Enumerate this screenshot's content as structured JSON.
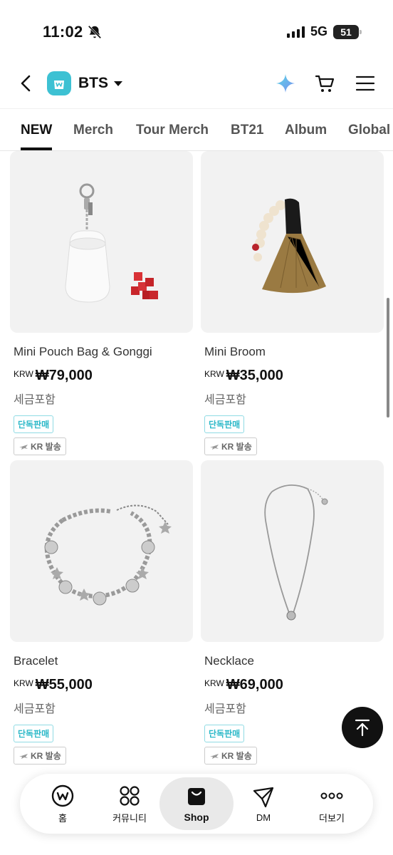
{
  "status": {
    "time": "11:02",
    "network": "5G",
    "battery": "51"
  },
  "header": {
    "brand": "BTS"
  },
  "tabs": [
    "NEW",
    "Merch",
    "Tour Merch",
    "BT21",
    "Album",
    "Global"
  ],
  "products": [
    {
      "name": "Mini Pouch Bag & Gonggi",
      "currency": "KRW",
      "price": "₩79,000",
      "tax": "세금포함",
      "badge": "단독판매",
      "shipping": "KR 발송"
    },
    {
      "name": "Mini Broom",
      "currency": "KRW",
      "price": "₩35,000",
      "tax": "세금포함",
      "badge": "단독판매",
      "shipping": "KR 발송"
    },
    {
      "name": "Bracelet",
      "currency": "KRW",
      "price": "₩55,000",
      "tax": "세금포함",
      "badge": "단독판매",
      "shipping": "KR 발송"
    },
    {
      "name": "Necklace",
      "currency": "KRW",
      "price": "₩69,000",
      "tax": "세금포함",
      "badge": "단독판매",
      "shipping": "KR 발송"
    }
  ],
  "nav": {
    "home": "홈",
    "community": "커뮤니티",
    "shop": "Shop",
    "dm": "DM",
    "more": "더보기"
  },
  "colors": {
    "accent": "#3dc1d3",
    "badge": "#2bb8c8"
  }
}
